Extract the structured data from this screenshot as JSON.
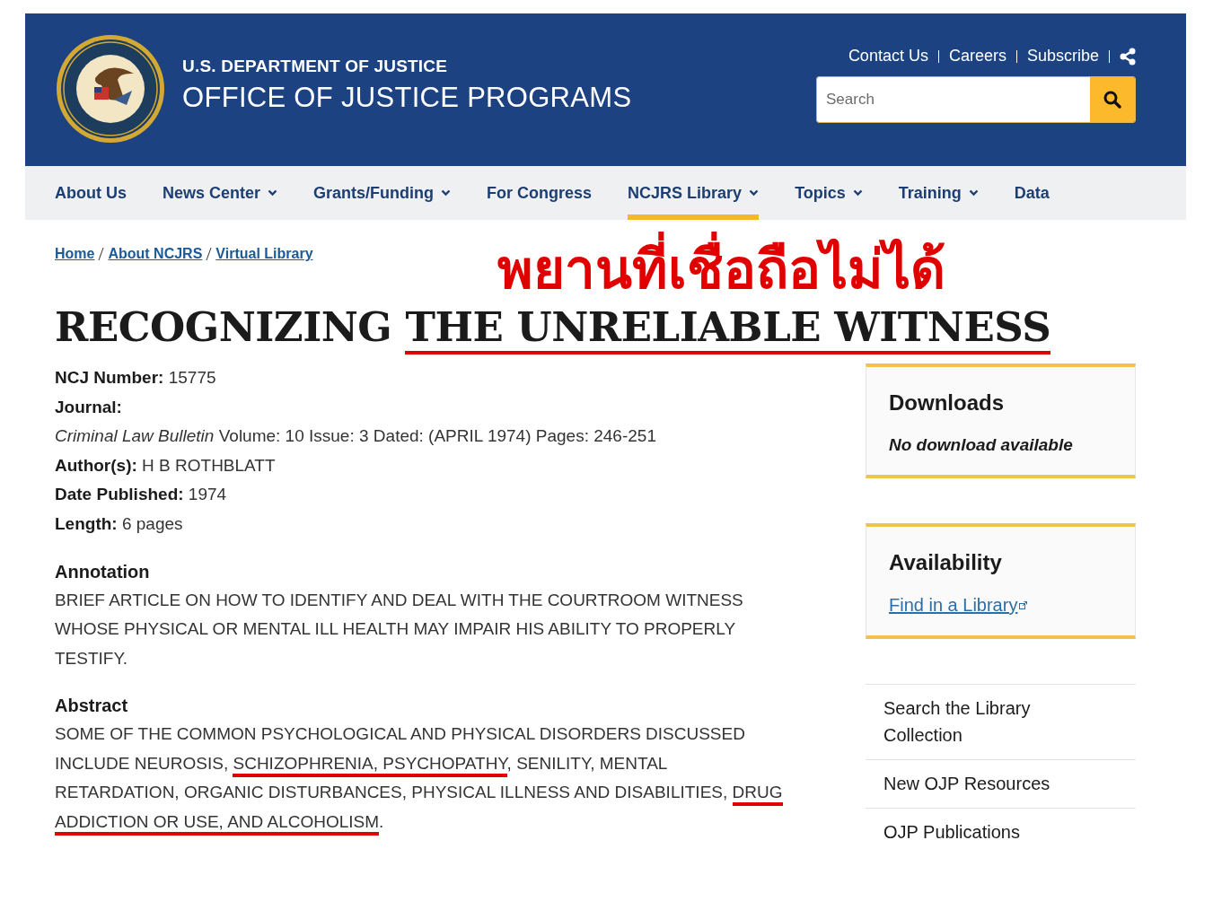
{
  "header": {
    "agency": "U.S. DEPARTMENT OF JUSTICE",
    "office": "OFFICE OF JUSTICE PROGRAMS",
    "utility_links": [
      "Contact Us",
      "Careers",
      "Subscribe"
    ],
    "search": {
      "placeholder": "Search"
    }
  },
  "nav": [
    {
      "label": "About Us",
      "dropdown": false,
      "selected": false
    },
    {
      "label": "News Center",
      "dropdown": true,
      "selected": false
    },
    {
      "label": "Grants/Funding",
      "dropdown": true,
      "selected": false
    },
    {
      "label": "For Congress",
      "dropdown": false,
      "selected": false
    },
    {
      "label": "NCJRS Library",
      "dropdown": true,
      "selected": true
    },
    {
      "label": "Topics",
      "dropdown": true,
      "selected": false
    },
    {
      "label": "Training",
      "dropdown": true,
      "selected": false
    },
    {
      "label": "Data",
      "dropdown": false,
      "selected": false
    }
  ],
  "breadcrumbs": [
    "Home",
    "About NCJRS",
    "Virtual Library"
  ],
  "overlay_caption": "พยานที่เชื่อถือไม่ได้",
  "title": [
    {
      "text": "RECOGNIZING ",
      "underlined": false
    },
    {
      "text": "THE UNRELIABLE WITNESS",
      "underlined": true
    }
  ],
  "fields": [
    "**NCJ Number:** 15775",
    "**Journal:**",
    "*Criminal Law Bulletin*  Volume: 10  Issue: 3  Dated: (APRIL 1974)  Pages: 246-251",
    "**Author(s):** H B ROTHBLATT",
    "**Date Published:** 1974",
    "**Length:** 6 pages"
  ],
  "sections": [
    {
      "heading": "Annotation",
      "segments": [
        {
          "text": "BRIEF ARTICLE ON HOW TO IDENTIFY AND DEAL WITH THE COURTROOM WITNESS WHOSE PHYSICAL OR MENTAL ILL HEALTH MAY IMPAIR HIS ABILITY TO PROPERLY TESTIFY.",
          "underlined": false
        }
      ]
    },
    {
      "heading": "Abstract",
      "segments": [
        {
          "text": "SOME OF THE COMMON PSYCHOLOGICAL AND PHYSICAL DISORDERS DISCUSSED INCLUDE NEUROSIS, ",
          "underlined": false
        },
        {
          "text": "SCHIZOPHRENIA, PSYCHOPATHY",
          "underlined": true
        },
        {
          "text": ", SENILITY, MENTAL RETARDATION, ORGANIC DISTURBANCES, PHYSICAL ILLNESS AND DISABILITIES, ",
          "underlined": false
        },
        {
          "text": "DRUG ADDICTION OR USE, AND ALCOHOLISM",
          "underlined": true
        },
        {
          "text": ".",
          "underlined": false
        }
      ]
    }
  ],
  "sidebar": {
    "cards": [
      {
        "title": "Downloads",
        "kind": "note",
        "text": "No download available"
      },
      {
        "title": "Availability",
        "kind": "link",
        "text": "Find in a Library"
      }
    ],
    "links": [
      "Search the Library Collection",
      "New OJP Resources",
      "OJP Publications"
    ]
  }
}
